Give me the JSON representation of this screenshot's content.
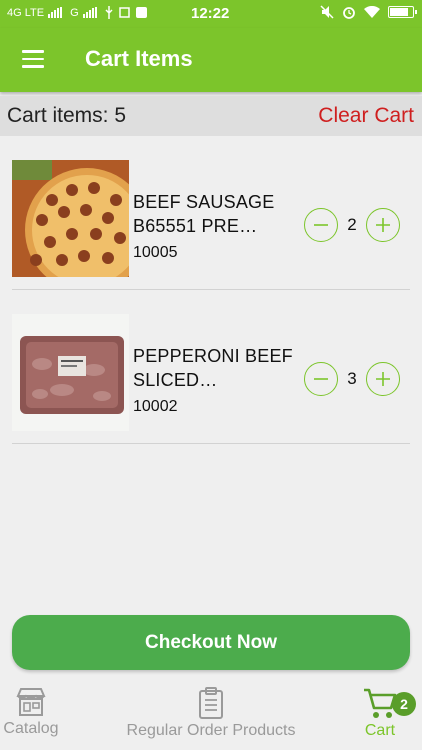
{
  "status_bar": {
    "network_left": "4G LTE",
    "network_right": "G",
    "time": "12:22"
  },
  "app_bar": {
    "title": "Cart Items"
  },
  "summary": {
    "cart_count": "Cart items: 5",
    "clear_label": "Clear Cart"
  },
  "items": [
    {
      "name": "BEEF SAUSAGE B65551 PRE…",
      "code": "10005",
      "quantity": "2",
      "image": "pizza-image"
    },
    {
      "name": "PEPPERONI BEEF SLICED…",
      "code": "10002",
      "quantity": "3",
      "image": "pepperoni-pack-image"
    }
  ],
  "checkout": {
    "label": "Checkout Now"
  },
  "bottom_nav": {
    "items": [
      {
        "label": "Catalog",
        "icon": "store-icon"
      },
      {
        "label": "Regular Order Products",
        "icon": "clipboard-icon"
      },
      {
        "label": "Cart",
        "icon": "cart-icon",
        "badge": "2"
      }
    ]
  },
  "colors": {
    "primary": "#7cc52b",
    "checkout": "#4cac4c",
    "danger": "#cf1f1f"
  }
}
